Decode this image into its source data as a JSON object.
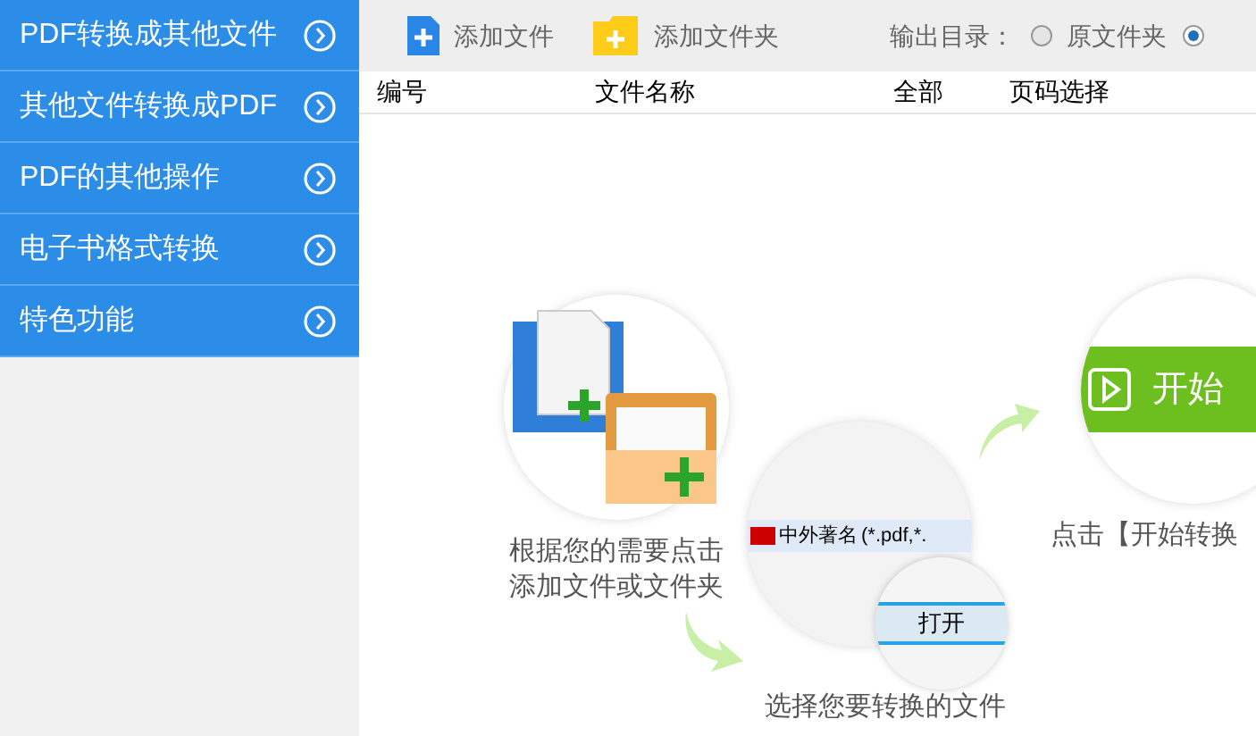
{
  "sidebar": {
    "items": [
      {
        "label": "PDF转换成其他文件",
        "selected": false
      },
      {
        "label": "其他文件转换成PDF",
        "selected": false
      },
      {
        "label": "PDF的其他操作",
        "selected": false
      },
      {
        "label": "电子书格式转换",
        "selected": false
      },
      {
        "label": "特色功能",
        "selected": false
      }
    ]
  },
  "toolbar": {
    "add_file": "添加文件",
    "add_folder": "添加文件夹",
    "output_label": "输出目录：",
    "options": [
      {
        "label": "原文件夹",
        "selected": false
      },
      {
        "selected": true
      }
    ]
  },
  "table": {
    "columns": [
      "编号",
      "文件名称",
      "全部",
      "页码选择"
    ]
  },
  "steps": [
    {
      "kind": "add",
      "caption": [
        "根据您的需要点击",
        "添加文件或文件夹"
      ]
    },
    {
      "kind": "dialog",
      "file_text": "中外著名",
      "filter_text": "(*.pdf,*.",
      "open_button": "打开",
      "caption": "选择您要转换的文件"
    },
    {
      "kind": "start",
      "button": "开始",
      "caption": "点击【开始转换"
    }
  ]
}
